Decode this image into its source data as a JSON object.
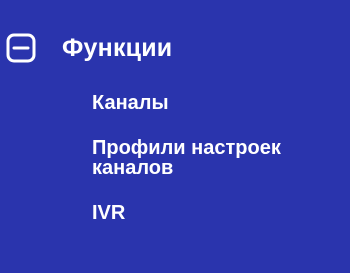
{
  "menu": {
    "group": {
      "title": "Функции",
      "toggle_icon": "minus-square-icon",
      "expanded": true
    },
    "items": [
      {
        "label": "Каналы"
      },
      {
        "label_line1": "Профили настроек",
        "label_line2": "каналов"
      },
      {
        "label": "IVR"
      }
    ]
  },
  "colors": {
    "background": "#2a34ad",
    "text": "#ffffff"
  }
}
